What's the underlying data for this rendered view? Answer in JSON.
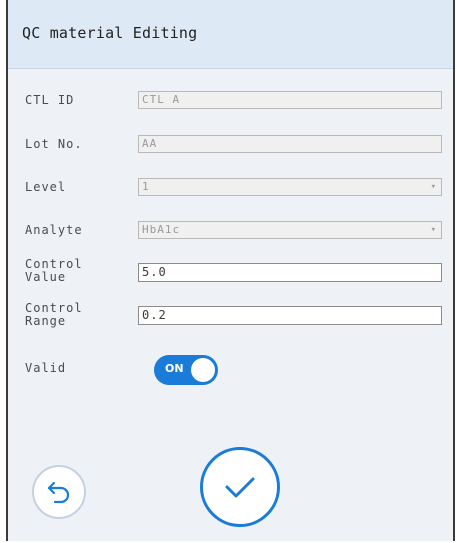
{
  "header": {
    "title": "QC material Editing"
  },
  "form": {
    "ctl_id": {
      "label": "CTL ID",
      "value": "CTL A"
    },
    "lot_no": {
      "label": "Lot No.",
      "value": "AA"
    },
    "level": {
      "label": "Level",
      "value": "1"
    },
    "analyte": {
      "label": "Analyte",
      "value": "HbA1c"
    },
    "control_value": {
      "label_line1": "Control",
      "label_line2": "Value",
      "value": "5.0"
    },
    "control_range": {
      "label_line1": "Control",
      "label_line2": "Range",
      "value": "0.2"
    },
    "valid": {
      "label": "Valid",
      "state": "ON"
    }
  },
  "icons": {
    "back": "undo-arrow-icon",
    "confirm": "checkmark-icon",
    "dropdown": "dropdown-arrow-icon"
  },
  "colors": {
    "accent": "#1a7cd8",
    "header_bg": "#dde9f5",
    "panel_bg": "#eef2f7"
  }
}
